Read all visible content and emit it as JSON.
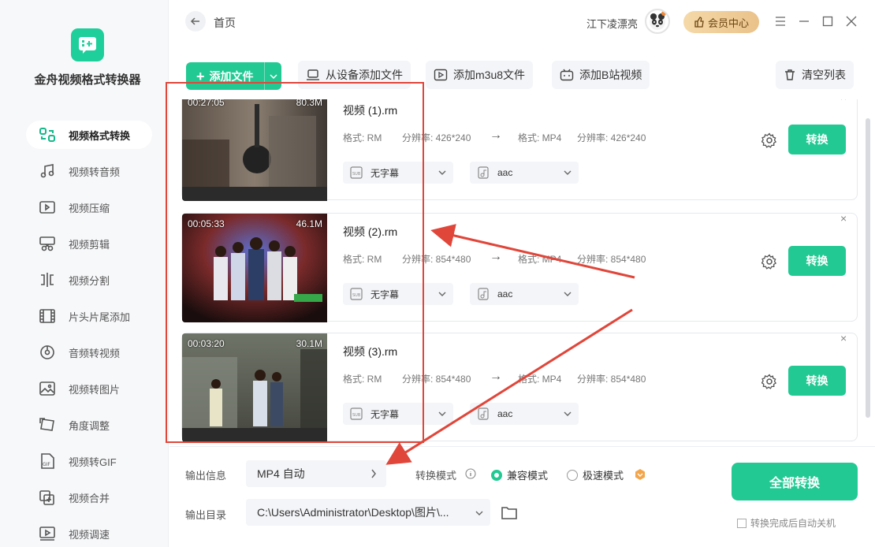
{
  "app": {
    "title": "金舟视频格式转换器"
  },
  "sidebar": {
    "items": [
      {
        "label": "视频格式转换",
        "icon": "convert-icon",
        "active": true
      },
      {
        "label": "视频转音频",
        "icon": "music-icon"
      },
      {
        "label": "视频压缩",
        "icon": "compress-icon"
      },
      {
        "label": "视频剪辑",
        "icon": "scissors-icon"
      },
      {
        "label": "视频分割",
        "icon": "split-icon"
      },
      {
        "label": "片头片尾添加",
        "icon": "film-icon"
      },
      {
        "label": "音频转视频",
        "icon": "disc-icon"
      },
      {
        "label": "视频转图片",
        "icon": "image-icon"
      },
      {
        "label": "角度调整",
        "icon": "rotate-icon"
      },
      {
        "label": "视频转GIF",
        "icon": "gif-icon"
      },
      {
        "label": "视频合并",
        "icon": "merge-icon"
      },
      {
        "label": "视频调速",
        "icon": "speed-icon"
      }
    ]
  },
  "topbar": {
    "breadcrumb": "首页",
    "username": "江下凌漂亮",
    "vip_label": "会员中心"
  },
  "toolbar": {
    "add_file": "添加文件",
    "add_device": "从设备添加文件",
    "add_m3u8": "添加m3u8文件",
    "add_bilibili": "添加B站视频",
    "clear_list": "清空列表"
  },
  "files": [
    {
      "name": "视频 (1).rm",
      "duration": "00:27:05",
      "size": "80.3M",
      "src_format_label": "格式: RM",
      "src_res_label": "分辨率: 426*240",
      "dst_format_label": "格式: MP4",
      "dst_res_label": "分辨率: 426*240",
      "subtitle": "无字幕",
      "audio": "aac",
      "convert": "转换"
    },
    {
      "name": "视频 (2).rm",
      "duration": "00:05:33",
      "size": "46.1M",
      "src_format_label": "格式: RM",
      "src_res_label": "分辨率: 854*480",
      "dst_format_label": "格式: MP4",
      "dst_res_label": "分辨率: 854*480",
      "subtitle": "无字幕",
      "audio": "aac",
      "convert": "转换"
    },
    {
      "name": "视频 (3).rm",
      "duration": "00:03:20",
      "size": "30.1M",
      "src_format_label": "格式: RM",
      "src_res_label": "分辨率: 854*480",
      "dst_format_label": "格式: MP4",
      "dst_res_label": "分辨率: 854*480",
      "subtitle": "无字幕",
      "audio": "aac",
      "convert": "转换"
    }
  ],
  "bottom": {
    "output_info_label": "输出信息",
    "output_format": "MP4 自动",
    "mode_label": "转换模式",
    "mode_compat": "兼容模式",
    "mode_fast": "极速模式",
    "output_dir_label": "输出目录",
    "output_dir": "C:\\Users\\Administrator\\Desktop\\图片\\...",
    "convert_all": "全部转换",
    "auto_shutdown": "转换完成后自动关机"
  },
  "colors": {
    "accent": "#22c993",
    "annotation": "#e0463a"
  }
}
